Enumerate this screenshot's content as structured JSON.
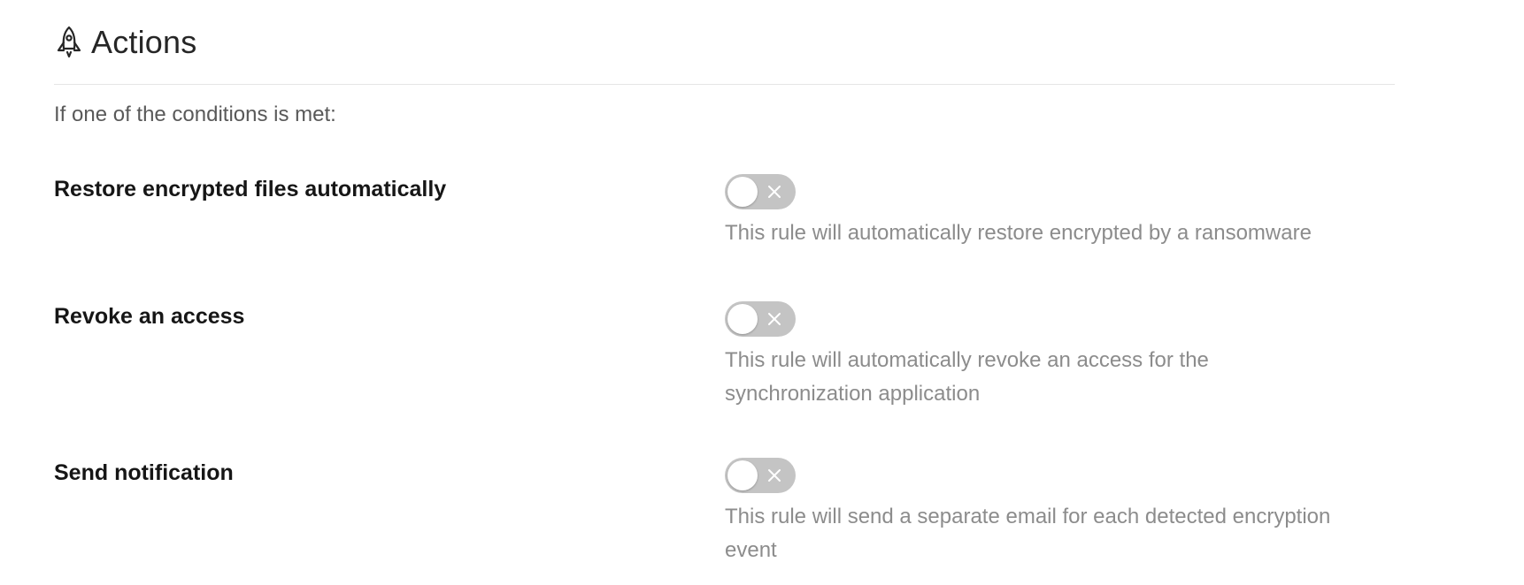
{
  "section": {
    "title": "Actions",
    "icon": "rocket-icon",
    "condition_text": "If one of the conditions is met:"
  },
  "rules": [
    {
      "label": "Restore encrypted files automatically",
      "enabled": false,
      "description": "This rule will automatically restore encrypted by a ransomware"
    },
    {
      "label": "Revoke an access",
      "enabled": false,
      "description": "This rule will automatically revoke an access for the synchronization application"
    },
    {
      "label": "Send notification",
      "enabled": false,
      "description": "This rule will send a separate email for each detected encryption event"
    }
  ],
  "colors": {
    "toggle_off": "#c4c4c4",
    "label_text": "#161616",
    "description_text": "#8c8c8c"
  }
}
